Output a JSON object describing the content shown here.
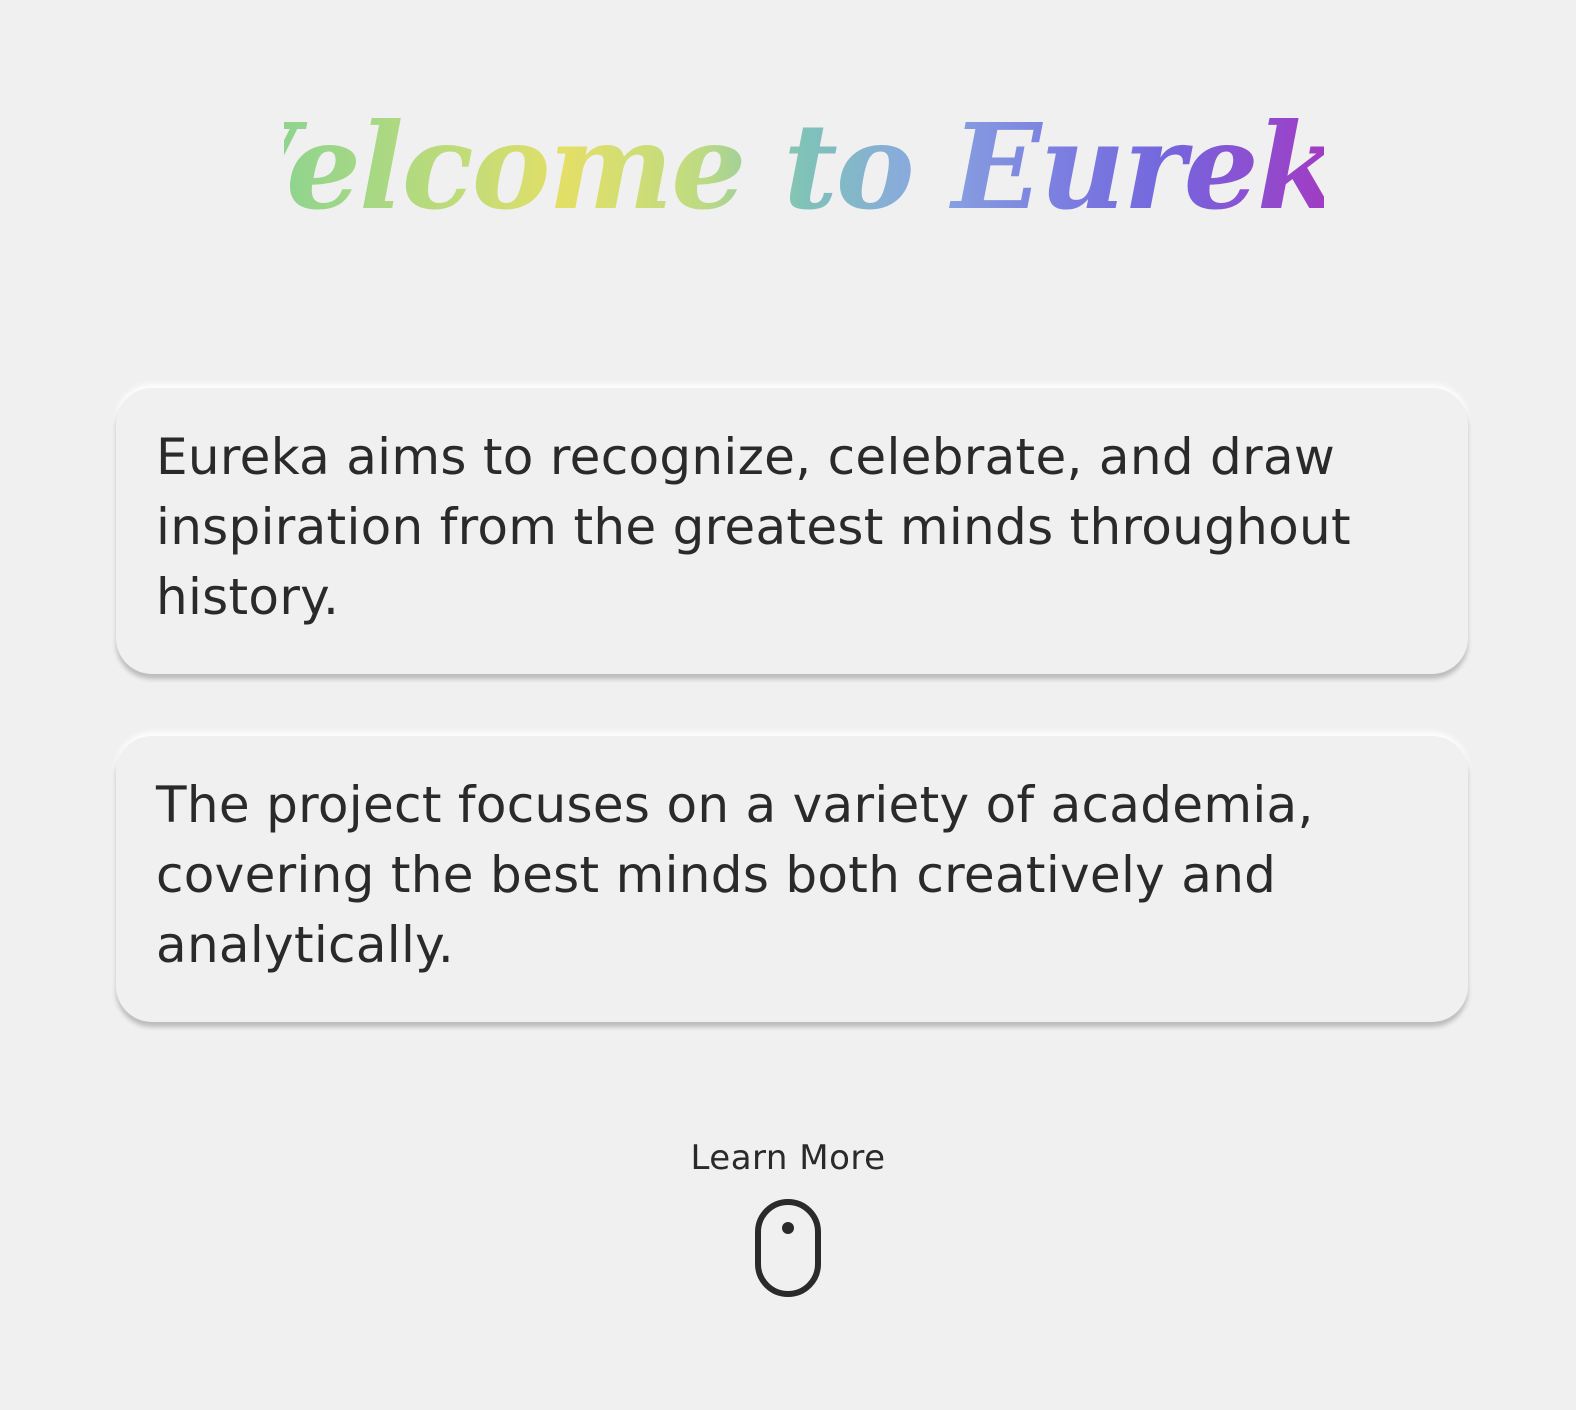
{
  "hero": {
    "title": "Welcome to Eureka"
  },
  "cards": [
    {
      "text": "Eureka aims to recognize, celebrate, and draw inspiration from the greatest minds throughout history."
    },
    {
      "text": "The project focuses on a variety of academia, covering the best minds both creatively and analytically."
    }
  ],
  "learn_more": {
    "label": "Learn More",
    "icon": "mouse-scroll-icon"
  },
  "colors": {
    "background": "#f0f0f0",
    "text": "#2a2a2a",
    "title_gradient": [
      "#8fd48e",
      "#e4df66",
      "#7fc2b8",
      "#7c80e0",
      "#a13cc4"
    ]
  }
}
